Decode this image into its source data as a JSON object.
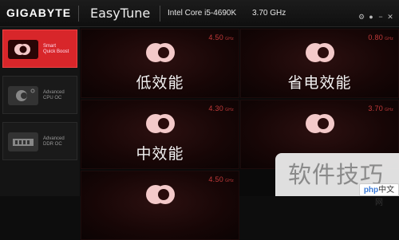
{
  "header": {
    "brand": "GIGABYTE",
    "app_title": "EasyTune",
    "cpu_model": "Intel Core i5-4690K",
    "cpu_frequency": "3.70 GHz",
    "controls": [
      "settings-icon",
      "info-icon",
      "minimize-icon",
      "close-icon"
    ]
  },
  "sidebar": {
    "items": [
      {
        "label_line1": "Smart",
        "label_line2": "Quick Boost",
        "active": true,
        "icon": "boost-icon"
      },
      {
        "label_line1": "Advanced",
        "label_line2": "CPU OC",
        "active": false,
        "icon": "cpu-icon"
      },
      {
        "label_line1": "Advanced",
        "label_line2": "DDR OC",
        "active": false,
        "icon": "ddr-icon"
      }
    ]
  },
  "modes": [
    {
      "name": "低效能",
      "freq": "4.50",
      "unit": "GHz"
    },
    {
      "name": "省电效能",
      "freq": "0.80",
      "unit": "GHz"
    },
    {
      "name": "中效能",
      "freq": "4.30",
      "unit": "GHz"
    },
    {
      "name": "",
      "freq": "3.70",
      "unit": "GHz"
    },
    {
      "name": "",
      "freq": "4.50",
      "unit": "GHz"
    }
  ],
  "watermark": {
    "text": "软件技巧",
    "logo_brand": "php",
    "logo_text": "中文网"
  },
  "colors": {
    "accent": "#d8262a",
    "card_bg": "#170606",
    "freq_text": "#c23a3a"
  }
}
